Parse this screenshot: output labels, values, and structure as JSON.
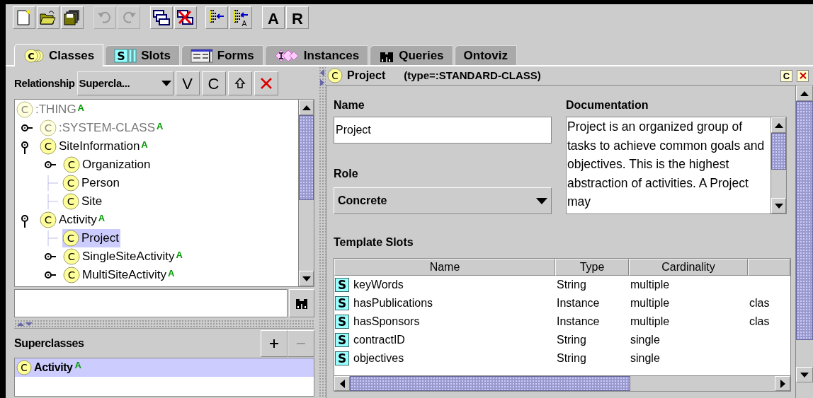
{
  "toolbar": [
    {
      "kind": "new",
      "disabled": false
    },
    {
      "kind": "open",
      "disabled": false
    },
    {
      "kind": "save",
      "disabled": false
    },
    {
      "kind": "undo",
      "disabled": true
    },
    {
      "kind": "redo",
      "disabled": true
    },
    {
      "kind": "cascade",
      "disabled": false
    },
    {
      "kind": "close-all",
      "disabled": false
    },
    {
      "kind": "tree",
      "disabled": false
    },
    {
      "kind": "tree-a",
      "icon_text": "A",
      "disabled": false
    },
    {
      "kind": "text",
      "label": "A",
      "disabled": false
    },
    {
      "kind": "text",
      "label": "R",
      "disabled": false
    }
  ],
  "tabs": [
    {
      "label": "Classes",
      "kind": "classes",
      "icon_text": "C",
      "selected": true
    },
    {
      "label": "Slots",
      "kind": "slots",
      "icon_text": "S",
      "selected": false
    },
    {
      "label": "Forms",
      "kind": "forms",
      "selected": false
    },
    {
      "label": "Instances",
      "kind": "instances",
      "selected": false
    },
    {
      "label": "Queries",
      "kind": "queries",
      "selected": false
    },
    {
      "label": "Ontoviz",
      "kind": "plain",
      "selected": false
    }
  ],
  "class_browser": {
    "relationship_label": "Relationship",
    "relationship_value": "Supercla...",
    "buttons": [
      "V",
      "C"
    ],
    "tree": [
      {
        "label": ":THING",
        "icon_text": "C",
        "system": true,
        "badge": "A",
        "selected": false,
        "children": [
          {
            "label": ":SYSTEM-CLASS",
            "icon_text": "C",
            "system": true,
            "badge": "A",
            "expanded": false,
            "selected": false
          },
          {
            "label": "SiteInformation",
            "icon_text": "C",
            "system": false,
            "badge": "A",
            "expanded": true,
            "selected": false,
            "children": [
              {
                "label": "Organization",
                "icon_text": "C",
                "system": false,
                "expanded": false,
                "selected": false
              },
              {
                "label": "Person",
                "icon_text": "C",
                "system": false,
                "selected": false
              },
              {
                "label": "Site",
                "icon_text": "C",
                "system": false,
                "selected": false
              }
            ]
          },
          {
            "label": "Activity",
            "icon_text": "C",
            "system": false,
            "badge": "A",
            "expanded": true,
            "selected": false,
            "children": [
              {
                "label": "Project",
                "icon_text": "C",
                "system": false,
                "selected": true
              },
              {
                "label": "SingleSiteActivity",
                "icon_text": "C",
                "system": false,
                "badge": "A",
                "expanded": false,
                "selected": false
              },
              {
                "label": "MultiSiteActivity",
                "icon_text": "C",
                "system": false,
                "badge": "A",
                "expanded": false,
                "selected": false
              }
            ]
          }
        ]
      }
    ]
  },
  "superclasses": {
    "title": "Superclasses",
    "items": [
      {
        "label": "Activity",
        "icon_text": "C",
        "badge": "A",
        "selected": true
      }
    ]
  },
  "class_form": {
    "icon_text": "C",
    "name": "Project",
    "type": "(type=:STANDARD-CLASS)",
    "header_button": "C",
    "name_label": "Name",
    "name_value": "Project",
    "documentation_label": "Documentation",
    "documentation": "Project is an organized group of tasks to achieve common goals and objectives. This is the highest abstraction of activities.  A Project may",
    "role_label": "Role",
    "role_value": "Concrete",
    "template_slots": {
      "title": "Template Slots",
      "columns": [
        "Name",
        "Type",
        "Cardinality"
      ],
      "rows": [
        {
          "icon_text": "S",
          "name": "keyWords",
          "type": "String",
          "cardinality": "multiple"
        },
        {
          "icon_text": "S",
          "name": "hasPublications",
          "type": "Instance",
          "cardinality": "multiple",
          "column_4": "clas"
        },
        {
          "icon_text": "S",
          "name": "hasSponsors",
          "type": "Instance",
          "cardinality": "multiple",
          "column_4": "clas"
        },
        {
          "icon_text": "S",
          "name": "contractID",
          "type": "String",
          "cardinality": "single"
        },
        {
          "icon_text": "S",
          "name": "objectives",
          "type": "String",
          "cardinality": "single"
        }
      ]
    }
  }
}
